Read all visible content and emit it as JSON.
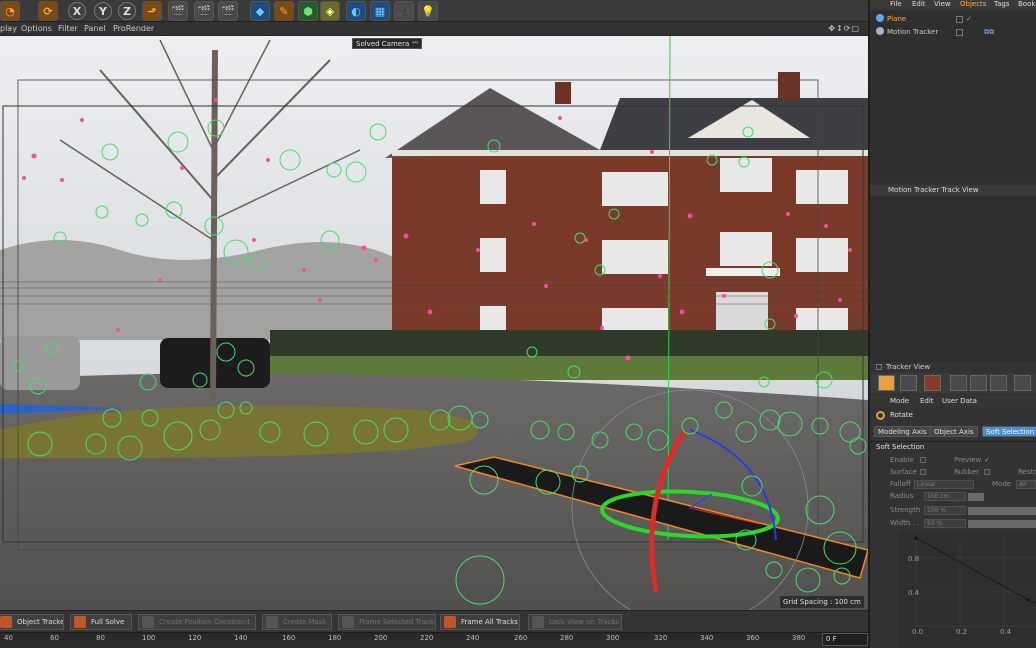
{
  "toolbar": {
    "axis_x": "X",
    "axis_y": "Y",
    "axis_z": "Z"
  },
  "viewport_menu": {
    "items": [
      "play",
      "Options",
      "Filter",
      "Panel",
      "ProRender"
    ],
    "nav_icons": "✥↕⟳▢"
  },
  "viewport": {
    "camera_label": "Solved Camera ⁺⁰",
    "grid_spacing": "Grid Spacing : 100 cm"
  },
  "bottom_bar": {
    "buttons": [
      {
        "label": "Object Tracker",
        "enabled": true
      },
      {
        "label": "Full Solve",
        "enabled": true
      },
      {
        "label": "Create Position Constraint",
        "enabled": false
      },
      {
        "label": "Create Mask",
        "enabled": false
      },
      {
        "label": "Frame Selected Tracks",
        "enabled": false
      },
      {
        "label": "Frame All Tracks",
        "enabled": true
      },
      {
        "label": "Lock View on Tracks",
        "enabled": false
      }
    ]
  },
  "timeline": {
    "ticks": [
      "40",
      "60",
      "80",
      "100",
      "120",
      "140",
      "160",
      "180",
      "200",
      "220",
      "240",
      "260",
      "280",
      "300",
      "320",
      "340",
      "360",
      "380"
    ],
    "current_frame": "0 F"
  },
  "object_manager": {
    "menu": [
      "File",
      "Edit",
      "View",
      "Objects",
      "Tags",
      "Bookm"
    ],
    "active_menu": "Objects",
    "objects": [
      {
        "name": "Plane",
        "selected": true
      },
      {
        "name": "Motion Tracker",
        "selected": false
      }
    ]
  },
  "track_view": {
    "title": "Motion Tracker Track View",
    "tracker_view_label": "Tracker View"
  },
  "attributes": {
    "menu": [
      "Mode",
      "Edit",
      "User Data"
    ],
    "tool_name": "Rotate",
    "tabs": [
      {
        "label": "Modeling Axis",
        "active": false
      },
      {
        "label": "Object Axis",
        "active": false
      },
      {
        "label": "Soft Selection",
        "active": true
      }
    ],
    "section": "Soft Selection",
    "enable_label": "Enable",
    "preview_label": "Preview",
    "preview_mark": "✓",
    "surface_label": "Surface",
    "rubber_label": "Rubber",
    "restrict_label": "Restri",
    "falloff_label": "Falloff",
    "falloff_value": "Linear",
    "mode_label": "Mode",
    "mode_value": "All",
    "radius_label": "Radius",
    "radius_value": "100 cm",
    "strength_label": "Strength",
    "strength_value": "100 %",
    "width_label": "Width . .",
    "width_value": "50 %",
    "curve_y_ticks": [
      "0.8",
      "0.4"
    ],
    "curve_x_ticks": [
      "0.0",
      "0.2",
      "0.4"
    ]
  },
  "colors": {
    "accent": "#ffb14a",
    "tab_active": "#4c8cd0",
    "track_green": "#40e070",
    "track_pink": "#ff4aa0"
  }
}
